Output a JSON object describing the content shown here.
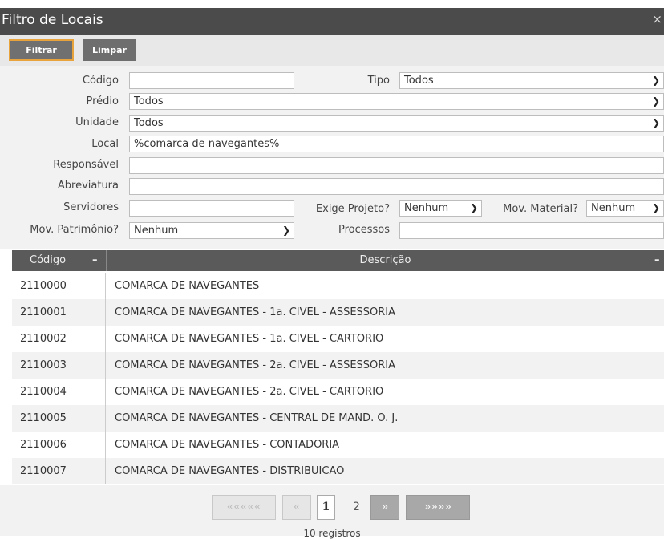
{
  "window": {
    "title": "Filtro de Locais",
    "close_glyph": "×"
  },
  "toolbar": {
    "filter_label": "Filtrar",
    "clear_label": "Limpar"
  },
  "form": {
    "codigo": {
      "label": "Código",
      "value": ""
    },
    "tipo": {
      "label": "Tipo",
      "value": "Todos"
    },
    "predio": {
      "label": "Prédio",
      "value": "Todos"
    },
    "unidade": {
      "label": "Unidade",
      "value": "Todos"
    },
    "local": {
      "label": "Local",
      "value": "%comarca de navegantes%"
    },
    "responsavel": {
      "label": "Responsável",
      "value": ""
    },
    "abreviatura": {
      "label": "Abreviatura",
      "value": ""
    },
    "servidores": {
      "label": "Servidores",
      "value": ""
    },
    "exige_projeto": {
      "label": "Exige Projeto?",
      "value": "Nenhum"
    },
    "mov_material": {
      "label": "Mov. Material?",
      "value": "Nenhum"
    },
    "mov_patrimonio": {
      "label": "Mov. Patrimônio?",
      "value": "Nenhum"
    },
    "processos": {
      "label": "Processos",
      "value": ""
    }
  },
  "table": {
    "columns": [
      "Código",
      "Descrição"
    ],
    "collapse_glyph": "–",
    "rows": [
      [
        "2110000",
        "COMARCA DE NAVEGANTES"
      ],
      [
        "2110001",
        "COMARCA DE NAVEGANTES - 1a. CIVEL - ASSESSORIA"
      ],
      [
        "2110002",
        "COMARCA DE NAVEGANTES - 1a. CIVEL - CARTORIO"
      ],
      [
        "2110003",
        "COMARCA DE NAVEGANTES - 2a. CIVEL - ASSESSORIA"
      ],
      [
        "2110004",
        "COMARCA DE NAVEGANTES - 2a. CIVEL - CARTORIO"
      ],
      [
        "2110005",
        "COMARCA DE NAVEGANTES - CENTRAL DE MAND. O. J."
      ],
      [
        "2110006",
        "COMARCA DE NAVEGANTES - CONTADORIA"
      ],
      [
        "2110007",
        "COMARCA DE NAVEGANTES - DISTRIBUICAO"
      ]
    ]
  },
  "pager": {
    "first": "«««««",
    "prev": "«",
    "pages": [
      "1",
      "2"
    ],
    "next": "»",
    "last": "»»»»",
    "count_text": "10 registros"
  },
  "colors": {
    "titlebar": "#4b4b4b",
    "header": "#5a5a5a",
    "accent": "#e8a33c",
    "row_alt": "#f2f2f2"
  }
}
